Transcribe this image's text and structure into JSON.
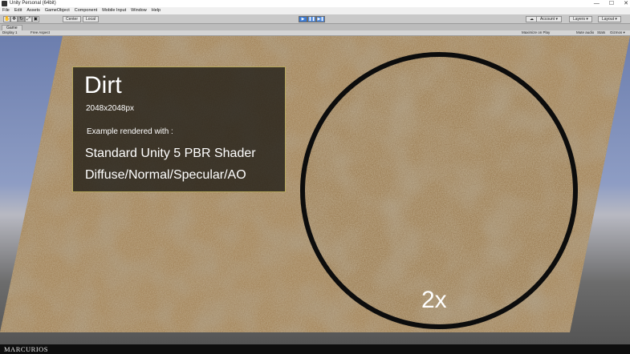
{
  "window": {
    "title": "Unity Personal (64bit)",
    "controls": [
      "—",
      "☐",
      "✕"
    ]
  },
  "menu": [
    "File",
    "Edit",
    "Assets",
    "GameObject",
    "Component",
    "Mobile Input",
    "Window",
    "Help"
  ],
  "toolbar": {
    "tools": [
      "hand-icon",
      "move-icon",
      "rotate-icon",
      "scale-icon",
      "rect-icon"
    ],
    "pivot_label": "Center",
    "space_label": "Local",
    "play_label": "▶",
    "pause_label": "❚❚",
    "step_label": "▶❚",
    "cloud_label": "☁",
    "account_label": "Account ▾",
    "layers_label": "Layers ▾",
    "layout_label": "Layout ▾"
  },
  "game_tab": {
    "label": "Game",
    "display": "Display 1",
    "aspect": "Free Aspect",
    "maximize": "Maximize on Play",
    "mute": "Mute audio",
    "stats": "Stats",
    "gizmos": "Gizmos ▾"
  },
  "scene": {
    "panel": {
      "title": "Dirt",
      "resolution": "2048x2048px",
      "example": "Example rendered with :",
      "shader": "Standard Unity 5 PBR Shader",
      "maps": "Diffuse/Normal/Specular/AO"
    },
    "zoom_label": "2x"
  },
  "footer": {
    "brand": "MARCURIOS"
  },
  "colors": {
    "dirt": "#a3845a",
    "sky": "#7383b3",
    "panel_border": "#b7a85c",
    "play_accent": "#3c7bd4"
  }
}
